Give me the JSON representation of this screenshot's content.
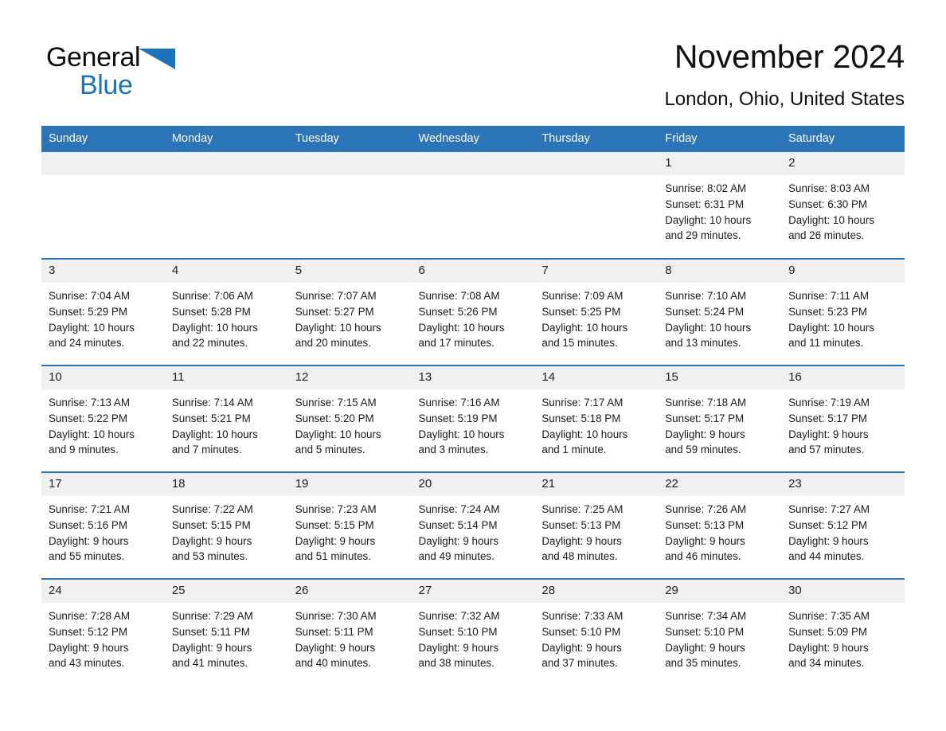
{
  "brand": {
    "name_part1": "General",
    "name_part2": "Blue",
    "triangle_color": "#1b74bb",
    "logo_icon": "general-blue-logo"
  },
  "header": {
    "title": "November 2024",
    "subtitle": "London, Ohio, United States"
  },
  "colors": {
    "header_blue": "#2b74b8",
    "daynum_band": "#f0f0f0",
    "text": "#1a1a1a",
    "page_background": "#ffffff"
  },
  "weekday_headers": [
    "Sunday",
    "Monday",
    "Tuesday",
    "Wednesday",
    "Thursday",
    "Friday",
    "Saturday"
  ],
  "labels": {
    "sunrise_prefix": "Sunrise:",
    "sunset_prefix": "Sunset:",
    "daylight_prefix": "Daylight:"
  },
  "weeks": [
    [
      {
        "day": "",
        "blank": true,
        "line1": "",
        "line2": "",
        "line3": "",
        "line4": ""
      },
      {
        "day": "",
        "blank": true,
        "line1": "",
        "line2": "",
        "line3": "",
        "line4": ""
      },
      {
        "day": "",
        "blank": true,
        "line1": "",
        "line2": "",
        "line3": "",
        "line4": ""
      },
      {
        "day": "",
        "blank": true,
        "line1": "",
        "line2": "",
        "line3": "",
        "line4": ""
      },
      {
        "day": "",
        "blank": true,
        "line1": "",
        "line2": "",
        "line3": "",
        "line4": ""
      },
      {
        "day": "1",
        "blank": false,
        "line1": "Sunrise: 8:02 AM",
        "line2": "Sunset: 6:31 PM",
        "line3": "Daylight: 10 hours",
        "line4": "and 29 minutes."
      },
      {
        "day": "2",
        "blank": false,
        "line1": "Sunrise: 8:03 AM",
        "line2": "Sunset: 6:30 PM",
        "line3": "Daylight: 10 hours",
        "line4": "and 26 minutes."
      }
    ],
    [
      {
        "day": "3",
        "blank": false,
        "line1": "Sunrise: 7:04 AM",
        "line2": "Sunset: 5:29 PM",
        "line3": "Daylight: 10 hours",
        "line4": "and 24 minutes."
      },
      {
        "day": "4",
        "blank": false,
        "line1": "Sunrise: 7:06 AM",
        "line2": "Sunset: 5:28 PM",
        "line3": "Daylight: 10 hours",
        "line4": "and 22 minutes."
      },
      {
        "day": "5",
        "blank": false,
        "line1": "Sunrise: 7:07 AM",
        "line2": "Sunset: 5:27 PM",
        "line3": "Daylight: 10 hours",
        "line4": "and 20 minutes."
      },
      {
        "day": "6",
        "blank": false,
        "line1": "Sunrise: 7:08 AM",
        "line2": "Sunset: 5:26 PM",
        "line3": "Daylight: 10 hours",
        "line4": "and 17 minutes."
      },
      {
        "day": "7",
        "blank": false,
        "line1": "Sunrise: 7:09 AM",
        "line2": "Sunset: 5:25 PM",
        "line3": "Daylight: 10 hours",
        "line4": "and 15 minutes."
      },
      {
        "day": "8",
        "blank": false,
        "line1": "Sunrise: 7:10 AM",
        "line2": "Sunset: 5:24 PM",
        "line3": "Daylight: 10 hours",
        "line4": "and 13 minutes."
      },
      {
        "day": "9",
        "blank": false,
        "line1": "Sunrise: 7:11 AM",
        "line2": "Sunset: 5:23 PM",
        "line3": "Daylight: 10 hours",
        "line4": "and 11 minutes."
      }
    ],
    [
      {
        "day": "10",
        "blank": false,
        "line1": "Sunrise: 7:13 AM",
        "line2": "Sunset: 5:22 PM",
        "line3": "Daylight: 10 hours",
        "line4": "and 9 minutes."
      },
      {
        "day": "11",
        "blank": false,
        "line1": "Sunrise: 7:14 AM",
        "line2": "Sunset: 5:21 PM",
        "line3": "Daylight: 10 hours",
        "line4": "and 7 minutes."
      },
      {
        "day": "12",
        "blank": false,
        "line1": "Sunrise: 7:15 AM",
        "line2": "Sunset: 5:20 PM",
        "line3": "Daylight: 10 hours",
        "line4": "and 5 minutes."
      },
      {
        "day": "13",
        "blank": false,
        "line1": "Sunrise: 7:16 AM",
        "line2": "Sunset: 5:19 PM",
        "line3": "Daylight: 10 hours",
        "line4": "and 3 minutes."
      },
      {
        "day": "14",
        "blank": false,
        "line1": "Sunrise: 7:17 AM",
        "line2": "Sunset: 5:18 PM",
        "line3": "Daylight: 10 hours",
        "line4": "and 1 minute."
      },
      {
        "day": "15",
        "blank": false,
        "line1": "Sunrise: 7:18 AM",
        "line2": "Sunset: 5:17 PM",
        "line3": "Daylight: 9 hours",
        "line4": "and 59 minutes."
      },
      {
        "day": "16",
        "blank": false,
        "line1": "Sunrise: 7:19 AM",
        "line2": "Sunset: 5:17 PM",
        "line3": "Daylight: 9 hours",
        "line4": "and 57 minutes."
      }
    ],
    [
      {
        "day": "17",
        "blank": false,
        "line1": "Sunrise: 7:21 AM",
        "line2": "Sunset: 5:16 PM",
        "line3": "Daylight: 9 hours",
        "line4": "and 55 minutes."
      },
      {
        "day": "18",
        "blank": false,
        "line1": "Sunrise: 7:22 AM",
        "line2": "Sunset: 5:15 PM",
        "line3": "Daylight: 9 hours",
        "line4": "and 53 minutes."
      },
      {
        "day": "19",
        "blank": false,
        "line1": "Sunrise: 7:23 AM",
        "line2": "Sunset: 5:15 PM",
        "line3": "Daylight: 9 hours",
        "line4": "and 51 minutes."
      },
      {
        "day": "20",
        "blank": false,
        "line1": "Sunrise: 7:24 AM",
        "line2": "Sunset: 5:14 PM",
        "line3": "Daylight: 9 hours",
        "line4": "and 49 minutes."
      },
      {
        "day": "21",
        "blank": false,
        "line1": "Sunrise: 7:25 AM",
        "line2": "Sunset: 5:13 PM",
        "line3": "Daylight: 9 hours",
        "line4": "and 48 minutes."
      },
      {
        "day": "22",
        "blank": false,
        "line1": "Sunrise: 7:26 AM",
        "line2": "Sunset: 5:13 PM",
        "line3": "Daylight: 9 hours",
        "line4": "and 46 minutes."
      },
      {
        "day": "23",
        "blank": false,
        "line1": "Sunrise: 7:27 AM",
        "line2": "Sunset: 5:12 PM",
        "line3": "Daylight: 9 hours",
        "line4": "and 44 minutes."
      }
    ],
    [
      {
        "day": "24",
        "blank": false,
        "line1": "Sunrise: 7:28 AM",
        "line2": "Sunset: 5:12 PM",
        "line3": "Daylight: 9 hours",
        "line4": "and 43 minutes."
      },
      {
        "day": "25",
        "blank": false,
        "line1": "Sunrise: 7:29 AM",
        "line2": "Sunset: 5:11 PM",
        "line3": "Daylight: 9 hours",
        "line4": "and 41 minutes."
      },
      {
        "day": "26",
        "blank": false,
        "line1": "Sunrise: 7:30 AM",
        "line2": "Sunset: 5:11 PM",
        "line3": "Daylight: 9 hours",
        "line4": "and 40 minutes."
      },
      {
        "day": "27",
        "blank": false,
        "line1": "Sunrise: 7:32 AM",
        "line2": "Sunset: 5:10 PM",
        "line3": "Daylight: 9 hours",
        "line4": "and 38 minutes."
      },
      {
        "day": "28",
        "blank": false,
        "line1": "Sunrise: 7:33 AM",
        "line2": "Sunset: 5:10 PM",
        "line3": "Daylight: 9 hours",
        "line4": "and 37 minutes."
      },
      {
        "day": "29",
        "blank": false,
        "line1": "Sunrise: 7:34 AM",
        "line2": "Sunset: 5:10 PM",
        "line3": "Daylight: 9 hours",
        "line4": "and 35 minutes."
      },
      {
        "day": "30",
        "blank": false,
        "line1": "Sunrise: 7:35 AM",
        "line2": "Sunset: 5:09 PM",
        "line3": "Daylight: 9 hours",
        "line4": "and 34 minutes."
      }
    ]
  ]
}
